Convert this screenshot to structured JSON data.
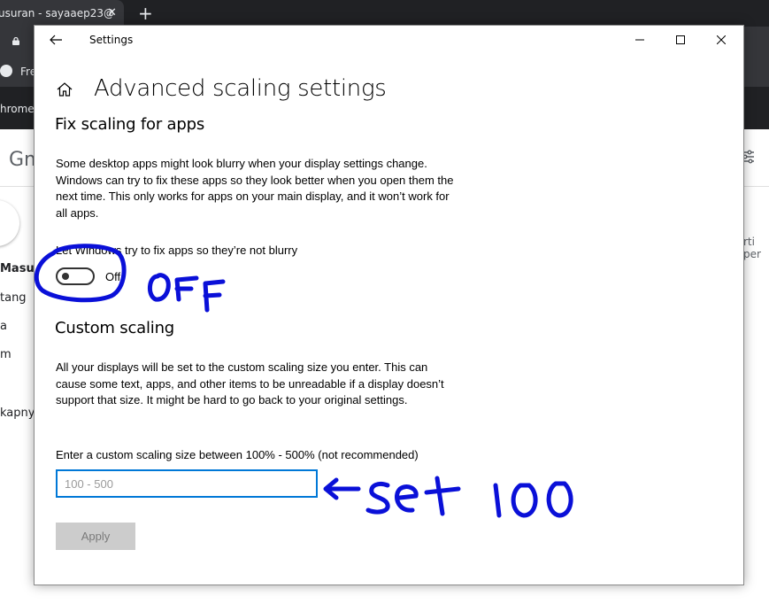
{
  "browser": {
    "tab_title": "usuran - sayaaep23@",
    "tab_close": "✕",
    "new_tab": "+",
    "bookmark_label": "Fre",
    "bar_text": "hrome"
  },
  "gmail": {
    "logo_text": "Gm",
    "side_items": [
      "Masuk",
      "tang",
      "a",
      "m",
      "kapny"
    ],
    "right_text": "rti per"
  },
  "settings": {
    "window_title": "Settings",
    "page_title": "Advanced scaling settings",
    "fix_section": {
      "heading": "Fix scaling for apps",
      "description": "Some desktop apps might look blurry when your display settings change. Windows can try to fix these apps so they look better when you open them the next time. This only works for apps on your main display, and it won’t work for all apps.",
      "toggle_label": "Let Windows try to fix apps so they’re not blurry",
      "toggle_state": "Off"
    },
    "custom_section": {
      "heading": "Custom scaling",
      "description": "All your displays will be set to the custom scaling size you enter. This can cause some text, apps, and other items to be unreadable if a display doesn’t support that size. It might be hard to go back to your original settings.",
      "field_label": "Enter a custom scaling size between 100% - 500% (not recommended)",
      "placeholder": "100 - 500",
      "value": "",
      "apply_label": "Apply"
    }
  },
  "annotations": {
    "off_note": "OFF",
    "set_note": "←set 100",
    "ink_color": "#0a10d8"
  }
}
